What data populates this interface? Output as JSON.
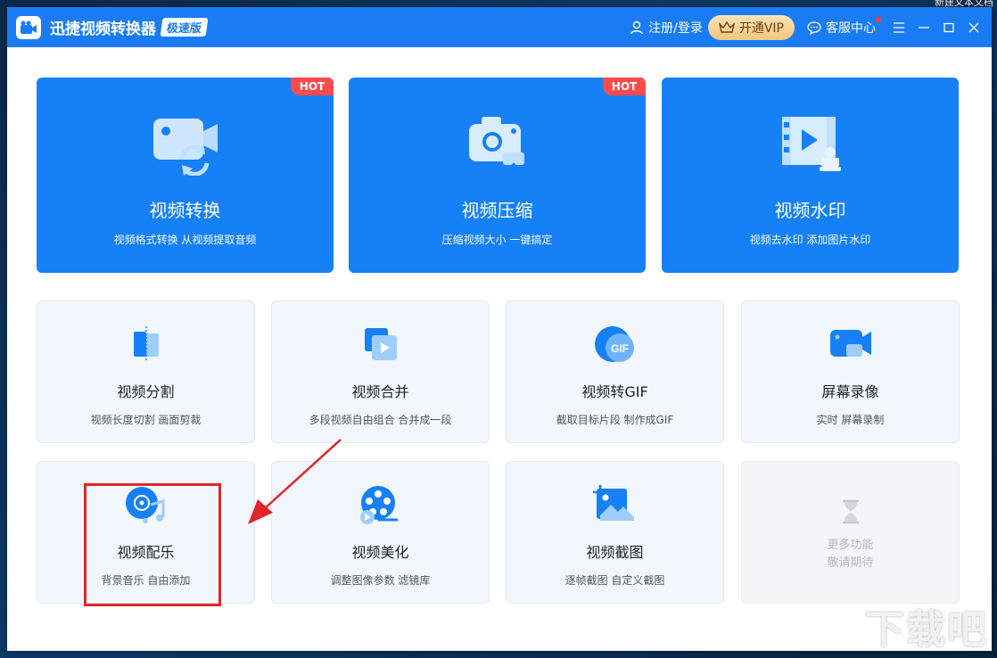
{
  "desktop": {
    "top_label": "新建文本文档"
  },
  "titlebar": {
    "app_title": "迅捷视频转换器",
    "badge": "极速版",
    "login": "注册/登录",
    "vip": "开通VIP",
    "service": "客服中心"
  },
  "big_cards": [
    {
      "title": "视频转换",
      "desc": "视频格式转换 从视频提取音频",
      "hot": "HOT"
    },
    {
      "title": "视频压缩",
      "desc": "压缩视频大小 一键搞定",
      "hot": "HOT"
    },
    {
      "title": "视频水印",
      "desc": "视频去水印 添加图片水印"
    }
  ],
  "small_cards": [
    {
      "title": "视频分割",
      "desc": "视频长度切割 画面剪裁"
    },
    {
      "title": "视频合并",
      "desc": "多段视频自由组合 合并成一段"
    },
    {
      "title": "视频转GIF",
      "desc": "截取目标片段 制作成GIF",
      "icon_text": "GIF"
    },
    {
      "title": "屏幕录像",
      "desc": "实时 屏幕录制"
    },
    {
      "title": "视频配乐",
      "desc": "背景音乐 自由添加"
    },
    {
      "title": "视频美化",
      "desc": "调整图像参数 滤镜库"
    },
    {
      "title": "视频截图",
      "desc": "逐帧截图 自定义截图"
    }
  ],
  "more": {
    "line1": "更多功能",
    "line2": "敬请期待"
  },
  "watermark": "下载吧",
  "colors": {
    "primary": "#1a7cf5",
    "card_blue": "#1680f7",
    "hot": "#ff4b4b",
    "highlight": "#e0262a"
  }
}
